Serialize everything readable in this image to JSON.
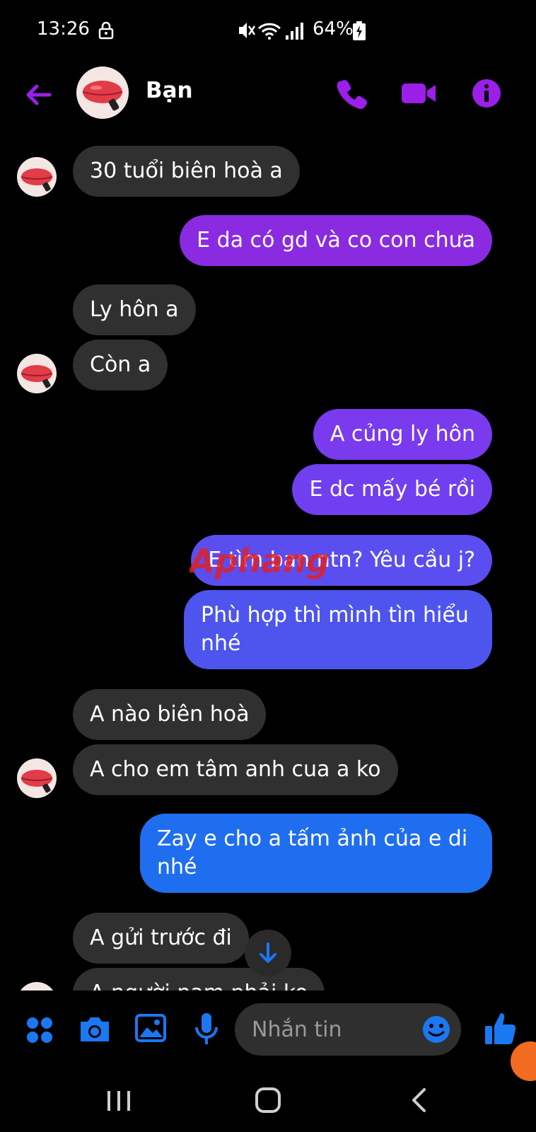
{
  "status_bar": {
    "time": "13:26",
    "battery": "64%",
    "icons": [
      "lock-icon",
      "mute-icon",
      "wifi-icon",
      "signal-icon",
      "battery-charging-icon"
    ]
  },
  "header": {
    "contact_name": "Bạn",
    "accent_color": "#9b1fe8"
  },
  "messages": [
    {
      "direction": "in",
      "text": "30 tuổi biên hoà a"
    },
    {
      "direction": "out",
      "text": "E da có gd và co con chưa",
      "color": "#8a2be2"
    },
    {
      "direction": "in",
      "text": "Ly hôn a"
    },
    {
      "direction": "in",
      "text": "Còn a"
    },
    {
      "direction": "out",
      "text": "A củng ly hôn",
      "color": "#7a3aed"
    },
    {
      "direction": "out",
      "text": "E dc mấy bé rồi",
      "color": "#6f3ff0"
    },
    {
      "direction": "out",
      "text": "E tìm ban ntn? Yêu cầu j?",
      "color": "#5a4ef0"
    },
    {
      "direction": "out",
      "text": "Phù hợp thì mình tìn hiểu\nnhé",
      "color": "#4d55ee"
    },
    {
      "direction": "in",
      "text": "A nào biên hoà"
    },
    {
      "direction": "in",
      "text": "A cho em tâm anh cua a ko"
    },
    {
      "direction": "out",
      "text": "Zay e cho a tấm ảnh của e di\nnhé",
      "color": "#1f6ef0"
    },
    {
      "direction": "in",
      "text": "A gửi trước đi"
    },
    {
      "direction": "in",
      "text": "A người nam phải ko"
    }
  ],
  "watermark": "Aphang",
  "composer": {
    "placeholder": "Nhắn tin",
    "icon_color": "#1a78f2"
  },
  "nav_bar": {
    "icons": [
      "recent-apps-icon",
      "home-icon",
      "back-icon"
    ]
  }
}
